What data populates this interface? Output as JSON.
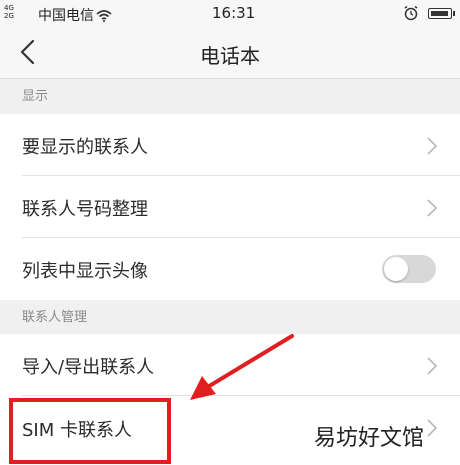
{
  "status_bar": {
    "network": "4G\n2G",
    "carrier": "中国电信",
    "time": "16:31",
    "icons": [
      "wifi-icon",
      "alarm-icon",
      "battery-icon"
    ]
  },
  "header": {
    "back_icon": "chevron-left-icon",
    "title": "电话本"
  },
  "sections": [
    {
      "title": "显示",
      "items": [
        {
          "label": "要显示的联系人",
          "control": "chevron-right-icon"
        },
        {
          "label": "联系人号码整理",
          "control": "chevron-right-icon"
        },
        {
          "label": "列表中显示头像",
          "control": "toggle",
          "toggle_on": false
        }
      ]
    },
    {
      "title": "联系人管理",
      "items": [
        {
          "label": "导入/导出联系人",
          "control": "chevron-right-icon"
        },
        {
          "label": "SIM 卡联系人",
          "control": "chevron-right-icon"
        }
      ]
    }
  ],
  "annotation": {
    "highlight_color": "#e02020",
    "arrow_color": "#e02020"
  },
  "watermark": "易坊好文馆"
}
